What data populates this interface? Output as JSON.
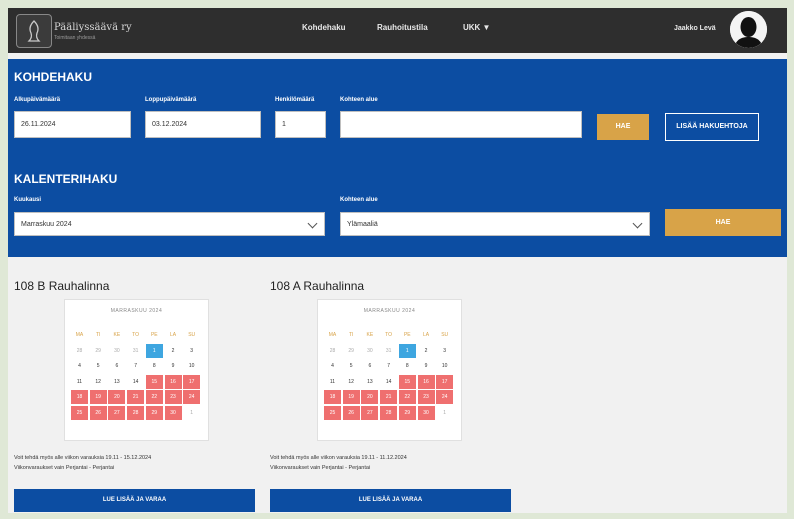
{
  "topbar": {
    "brand": "Pääliyssäävä ry",
    "brand_sub": "Toimitaan yhdessä",
    "nav": [
      "Kohdehaku",
      "Rauhoitustila",
      "UKK ▼"
    ],
    "username": "Jaakko Levä"
  },
  "kohdehaku": {
    "title": "KOHDEHAKU",
    "start_label": "Alkupäivämäärä",
    "start_value": "26.11.2024",
    "end_label": "Loppupäivämäärä",
    "end_value": "03.12.2024",
    "count_label": "Henkilömäärä",
    "count_value": "1",
    "area_label": "Kohteen alue",
    "area_value": "",
    "search_button": "HAE",
    "more_filters_button": "LISÄÄ HAKUEHTOJA"
  },
  "kalenterihaku": {
    "title": "KALENTERIHAKU",
    "month_label": "Kuukausi",
    "month_value": "Marraskuu 2024",
    "area_label": "Kohteen alue",
    "area_value": "Ylämaaliä",
    "search_button": "HAE"
  },
  "properties": [
    {
      "name": "108 B Rauhalinna",
      "month": "MARRASKUU 2024",
      "weekdays": [
        "MA",
        "TI",
        "KE",
        "TO",
        "PE",
        "LA",
        "SU"
      ],
      "days": [
        "28",
        "29",
        "30",
        "31",
        "1",
        "2",
        "3",
        "4",
        "5",
        "6",
        "7",
        "8",
        "9",
        "10",
        "11",
        "12",
        "13",
        "14",
        "15",
        "16",
        "17",
        "18",
        "19",
        "20",
        "21",
        "22",
        "23",
        "24",
        "25",
        "26",
        "27",
        "28",
        "29",
        "30",
        "1"
      ],
      "desc1": "Voit tehdä myös alle viikon varauksia 19.11 - 15.12.2024",
      "desc2": "Viikonvaraukset vain Perjantai - Perjantai",
      "button": "LUE LISÄÄ JA VARAA"
    },
    {
      "name": "108 A Rauhalinna",
      "month": "MARRASKUU 2024",
      "weekdays": [
        "MA",
        "TI",
        "KE",
        "TO",
        "PE",
        "LA",
        "SU"
      ],
      "days": [
        "28",
        "29",
        "30",
        "31",
        "1",
        "2",
        "3",
        "4",
        "5",
        "6",
        "7",
        "8",
        "9",
        "10",
        "11",
        "12",
        "13",
        "14",
        "15",
        "16",
        "17",
        "18",
        "19",
        "20",
        "21",
        "22",
        "23",
        "24",
        "25",
        "26",
        "27",
        "28",
        "29",
        "30",
        "1"
      ],
      "desc1": "Voit tehdä myös alle viikon varauksia 19.11 - 11.12.2024",
      "desc2": "Viikonvaraukset vain Perjantai - Perjantai",
      "button": "LUE LISÄÄ JA VARAA"
    }
  ],
  "colors": {
    "topbar": "#2e2e2e",
    "panel": "#0c4da2",
    "gold": "#d8a348",
    "booked": "#ef6f6f",
    "today": "#3ea6e0"
  }
}
